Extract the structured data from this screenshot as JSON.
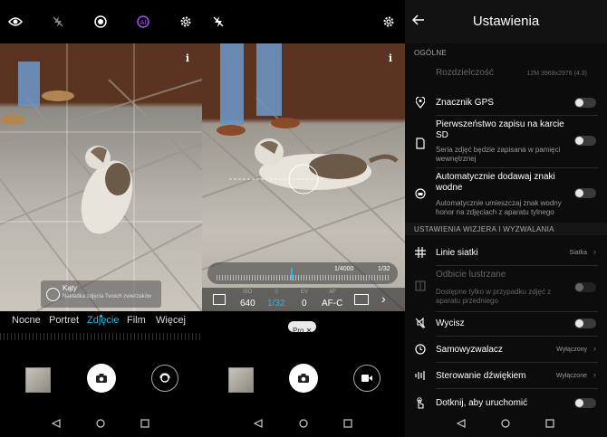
{
  "colors": {
    "accent": "#27b7e8",
    "pro_cyan": "#27b7e8"
  },
  "panel1": {
    "top_icons": [
      "eye-icon",
      "flash-off-icon",
      "aperture-icon",
      "ai-icon",
      "gear-icon"
    ],
    "info_label": "i",
    "hint": {
      "title": "Kąty",
      "text": "Nakładka zdjęcia Twoich zwierzaków"
    },
    "modes": [
      "Nocne",
      "Portret",
      "Zdjęcie",
      "Film",
      "Więcej"
    ],
    "active_mode": "Zdjęcie"
  },
  "panel2": {
    "top_icons": [
      "flash-off-icon",
      "gear-icon"
    ],
    "info_label": "i",
    "shutter_speed_top": "1/4000",
    "shutter_speed_current": "1/32",
    "pro_params": [
      {
        "label": "ISO",
        "value": "640"
      },
      {
        "label": "S",
        "value": "1/32"
      },
      {
        "label": "EV",
        "value": "0"
      },
      {
        "label": "AF",
        "value": "AF-C"
      }
    ],
    "pro_badge": "Pro ✕"
  },
  "settings": {
    "title": "Ustawienia",
    "section_general": "OGÓLNE",
    "resolution": {
      "label": "Rozdzielczość",
      "value": "12M 3968x2976 (4:3)"
    },
    "gps": {
      "label": "Znacznik GPS"
    },
    "sd": {
      "label1": "Pierwszeństwo zapisu na karcie",
      "label2": "SD",
      "sub1": "Seria zdjęć będzie zapisana w pamięci",
      "sub2": "wewnętrznej"
    },
    "watermark": {
      "label1": "Automatycznie dodawaj znaki",
      "label2": "wodne",
      "sub1": "Automatycznie umieszczaj znak wodny",
      "sub2": "honor na zdjęciach z aparatu tylnego"
    },
    "section_viewfinder": "USTAWIENIA WIZJERA I WYZWALANIA",
    "grid": {
      "label": "Linie siatki",
      "value": "Siatka"
    },
    "mirror": {
      "label": "Odbicie lustrzane",
      "sub1": "Dostępne tylko w przypadku zdjęć z",
      "sub2": "aparatu przedniego"
    },
    "mute": {
      "label": "Wycisz"
    },
    "timer": {
      "label": "Samowyzwalacz",
      "value": "Wyłączony"
    },
    "voice": {
      "label": "Sterowanie dźwiękiem",
      "value": "Wyłączone"
    },
    "touch": {
      "label": "Dotknij, aby uruchomić"
    }
  }
}
